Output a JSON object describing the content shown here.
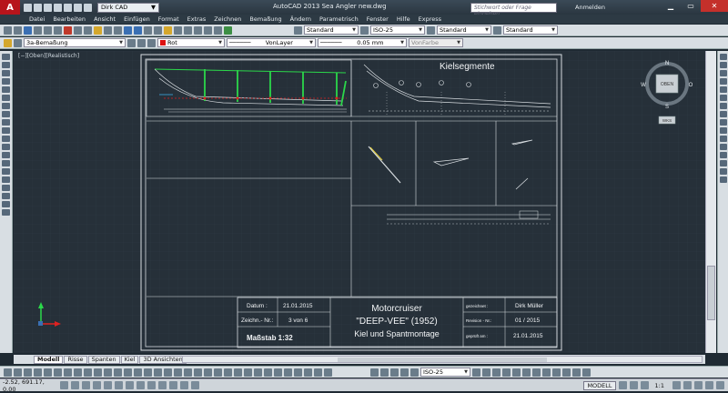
{
  "titlebar": {
    "app_logo": "A",
    "workspace": "Dirk CAD",
    "title": "AutoCAD 2013    Sea Angler new.dwg",
    "search_placeholder": "Stichwort oder Frage eingeben",
    "login": "Anmelden"
  },
  "menu": [
    "Datei",
    "Bearbeiten",
    "Ansicht",
    "Einfügen",
    "Format",
    "Extras",
    "Zeichnen",
    "Bemaßung",
    "Ändern",
    "Parametrisch",
    "Fenster",
    "Hilfe",
    "Express"
  ],
  "toolbar1": {
    "textstyle": "Standard",
    "dimstyle": "ISO-25",
    "tablestyle": "Standard",
    "mleaderstyle": "Standard"
  },
  "toolbar2": {
    "layer": "3a-Bemaßung",
    "color": "Rot",
    "linetype": "VonLayer",
    "lineweight": "0.05 mm",
    "plotstyle": "VonFarbe"
  },
  "canvas": {
    "view_label": "[−][Oben][Realistisch]",
    "title_block": {
      "datum_label": "Datum :",
      "datum_value": "21.01.2015",
      "zeichn_label": "Zeichn.- Nr.:",
      "zeichn_value": "3 von 6",
      "massstab": "Maßstab 1:32",
      "project_line1": "Motorcruiser",
      "project_line2": "\"DEEP-VEE\" (1952)",
      "project_line3": "Kiel und Spantmontage",
      "gezeichnet_label": "gezeichnet :",
      "gezeichnet_value": "Dirk Müller",
      "revision_label": "Revision - Nr.:",
      "revision_value": "01 / 2015",
      "geprueft_label": "geprüft am :",
      "geprueft_value": "21.01.2015"
    },
    "kielsegmente_title": "Kielsegmente",
    "viewcube": {
      "face": "OBEN",
      "n": "N",
      "s": "S",
      "w": "W",
      "o": "O",
      "wks": "WKS"
    }
  },
  "tabs": [
    "Modell",
    "Risse",
    "Spanten",
    "Kiel",
    "3D Ansichten"
  ],
  "bottom_toolbar": {
    "dimstyle": "ISO-25"
  },
  "status": {
    "coords": "-2.52, 691.17, 0.00",
    "model": "MODELL",
    "scale": "1:1"
  }
}
